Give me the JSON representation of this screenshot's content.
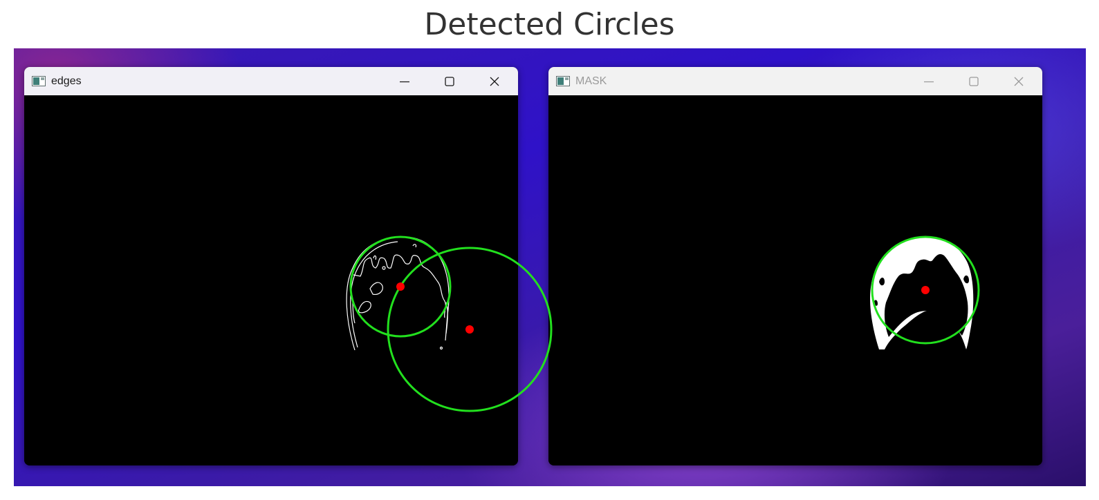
{
  "figure": {
    "title": "Detected Circles"
  },
  "windows": [
    {
      "id": "edges",
      "title": "edges",
      "active": true
    },
    {
      "id": "mask",
      "title": "MASK",
      "active": false
    }
  ],
  "colors": {
    "circle": "#22e01e",
    "center": "#ff0000",
    "foreground": "#ffffff",
    "background": "#000000"
  },
  "icons": {
    "app": "opencv-window-icon",
    "minimize": "minimize-icon",
    "maximize": "maximize-icon",
    "close": "close-icon"
  }
}
